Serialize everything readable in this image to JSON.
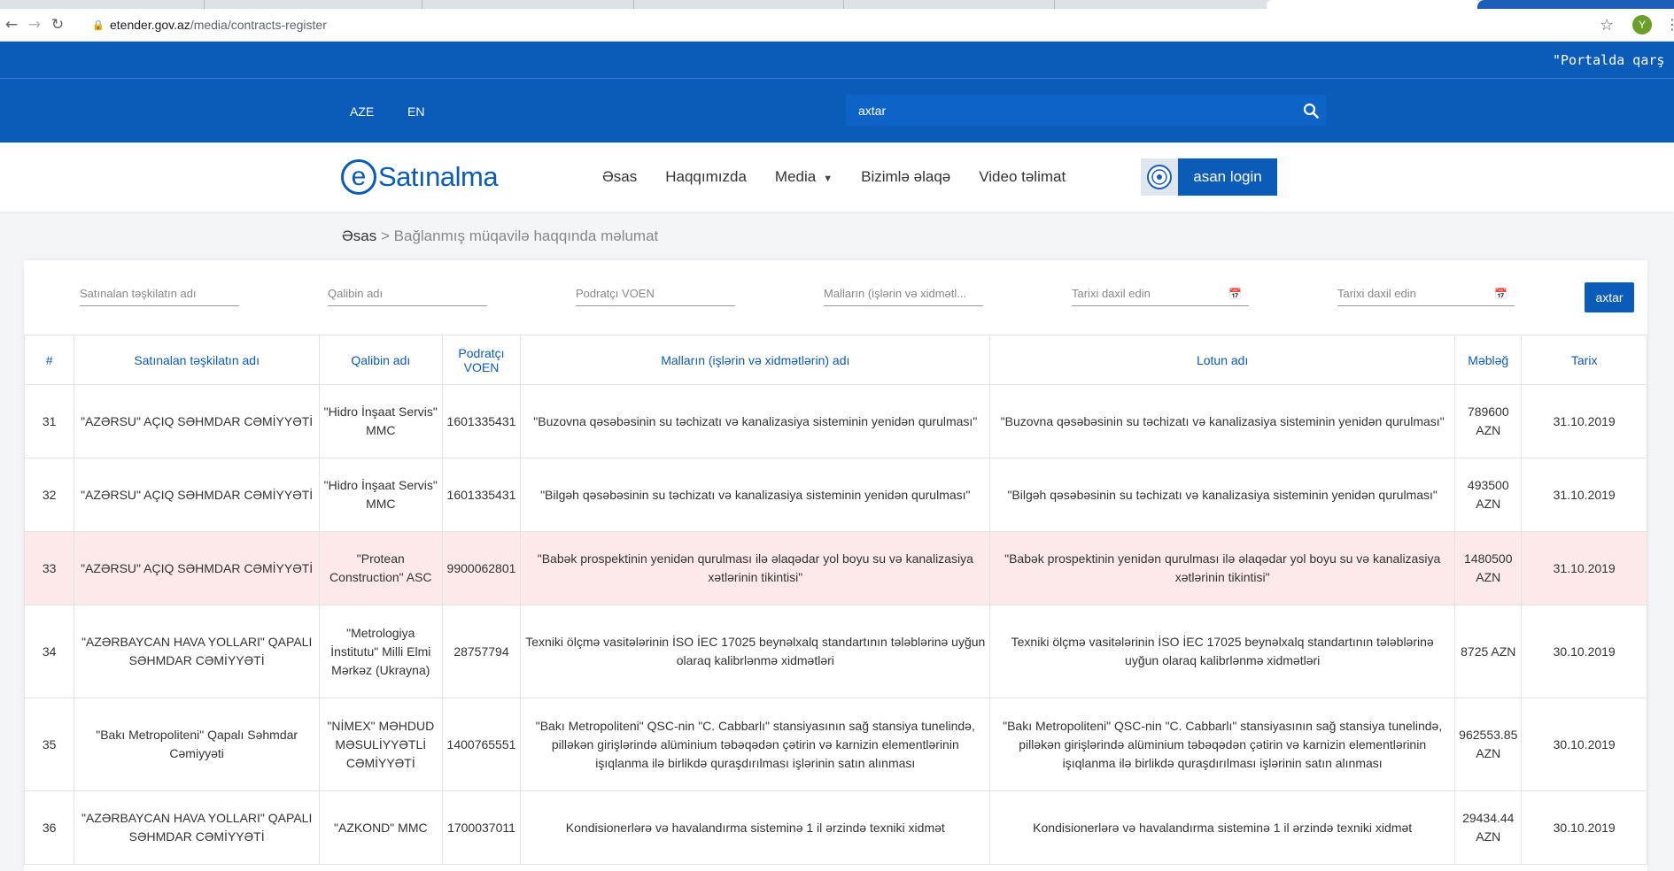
{
  "browser": {
    "url_domain": "etender.gov.az",
    "url_path": "/media/contracts-register",
    "avatar_letter": "Y"
  },
  "ticker": {
    "text": "\"Portalda qarş"
  },
  "lang": {
    "aze": "AZE",
    "en": "EN"
  },
  "search": {
    "placeholder": "axtar"
  },
  "logo": {
    "e": "e",
    "text": "Satınalma"
  },
  "nav": {
    "items": [
      "Əsas",
      "Haqqımızda",
      "Media",
      "Bizimlə əlaqə",
      "Video təlimat"
    ],
    "login_label": "asan login"
  },
  "breadcrumb": {
    "home": "Əsas",
    "separator": ">",
    "current": "Bağlanmış müqavilə haqqında məlumat"
  },
  "filters": {
    "org": "Satınalan təşkilatın adı",
    "winner": "Qalibin adı",
    "voen": "Podratçı VOEN",
    "goods": "Malların (işlərin və xidmətl...",
    "date_from": "Tarixi daxil edin",
    "date_to": "Tarixi daxil edin",
    "search_label": "axtar"
  },
  "table": {
    "headers": [
      "#",
      "Satınalan təşkilatın adı",
      "Qalibin adı",
      "Podratçı VOEN",
      "Malların (işlərin və xidmətlərin) adı",
      "Lotun adı",
      "Məbləğ",
      "Tarix"
    ],
    "rows": [
      {
        "n": "31",
        "org": "\"AZƏRSU\" AÇIQ SƏHMDAR CƏMİYYƏTİ",
        "winner": "\"Hidro İnşaat Servis\" MMC",
        "voen": "1601335431",
        "goods": "\"Buzovna qəsəbəsinin su təchizatı və kanalizasiya sisteminin yenidən qurulması\"",
        "lot": "\"Buzovna qəsəbəsinin su təchizatı və kanalizasiya sisteminin yenidən qurulması\"",
        "amount": "789600 AZN",
        "date": "31.10.2019"
      },
      {
        "n": "32",
        "org": "\"AZƏRSU\" AÇIQ SƏHMDAR CƏMİYYƏTİ",
        "winner": "\"Hidro İnşaat Servis\" MMC",
        "voen": "1601335431",
        "goods": "\"Bilgəh qəsəbəsinin su təchizatı və kanalizasiya sisteminin yenidən qurulması\"",
        "lot": "\"Bilgəh qəsəbəsinin su təchizatı və kanalizasiya sisteminin yenidən qurulması\"",
        "amount": "493500 AZN",
        "date": "31.10.2019"
      },
      {
        "n": "33",
        "org": "\"AZƏRSU\" AÇIQ SƏHMDAR CƏMİYYƏTİ",
        "winner": "\"Protean Construction\" ASC",
        "voen": "9900062801",
        "goods": "\"Babək prospektinin yenidən qurulması ilə əlaqədar yol boyu su və kanalizasiya xətlərinin tikintisi\"",
        "lot": "\"Babək prospektinin yenidən qurulması ilə əlaqədar yol boyu su və kanalizasiya xətlərinin tikintisi\"",
        "amount": "1480500 AZN",
        "date": "31.10.2019"
      },
      {
        "n": "34",
        "org": "\"AZƏRBAYCAN HAVA YOLLARI\" QAPALI SƏHMDAR CƏMİYYƏTİ",
        "winner": "\"Metrologiya İnstitutu\" Milli Elmi Mərkəz (Ukrayna)",
        "voen": "28757794",
        "goods": "Texniki ölçmə vasitələrinin İSO İEC 17025 beynəlxalq standartının tələblərinə uyğun olaraq kalibrlənmə xidmətləri",
        "lot": "Texniki ölçmə vasitələrinin İSO İEC 17025 beynəlxalq standartının tələblərinə uyğun olaraq kalibrlənmə xidmətləri",
        "amount": "8725 AZN",
        "date": "30.10.2019"
      },
      {
        "n": "35",
        "org": "\"Bakı Metropoliteni\" Qapalı Səhmdar Cəmiyyəti",
        "winner": "\"NİMEX\" MƏHDUD MƏSULİYYƏTLİ CƏMİYYƏTİ",
        "voen": "1400765551",
        "goods": "\"Bakı Metropoliteni\" QSC-nin \"C. Cabbarlı\" stansiyasının sağ stansiya tunelində, pilləkən girişlərində alüminium təbəqədən çətirin və karnizin elementlərinin işıqlanma ilə birlikdə quraşdırılması işlərinin satın alınması",
        "lot": "\"Bakı Metropoliteni\" QSC-nin \"C. Cabbarlı\" stansiyasının sağ stansiya tunelində, pilləkən girişlərində alüminium təbəqədən çətirin və karnizin elementlərinin işıqlanma ilə birlikdə quraşdırılması işlərinin satın alınması",
        "amount": "962553.85 AZN",
        "date": "30.10.2019"
      },
      {
        "n": "36",
        "org": "\"AZƏRBAYCAN HAVA YOLLARI\" QAPALI SƏHMDAR CƏMİYYƏTİ",
        "winner": "\"AZKOND\" MMC",
        "voen": "1700037011",
        "goods": "Kondisionerlərə və havalandırma sisteminə 1 il ərzində texniki xidmət",
        "lot": "Kondisionerlərə və havalandırma sisteminə 1 il ərzində texniki xidmət",
        "amount": "29434.44 AZN",
        "date": "30.10.2019"
      }
    ]
  },
  "colors": {
    "brand": "#0b5bb9",
    "highlight_row": "#fde8ea"
  },
  "icons": {
    "search": "search-icon",
    "calendar": "calendar-icon",
    "caret": "chevron-down-icon"
  }
}
